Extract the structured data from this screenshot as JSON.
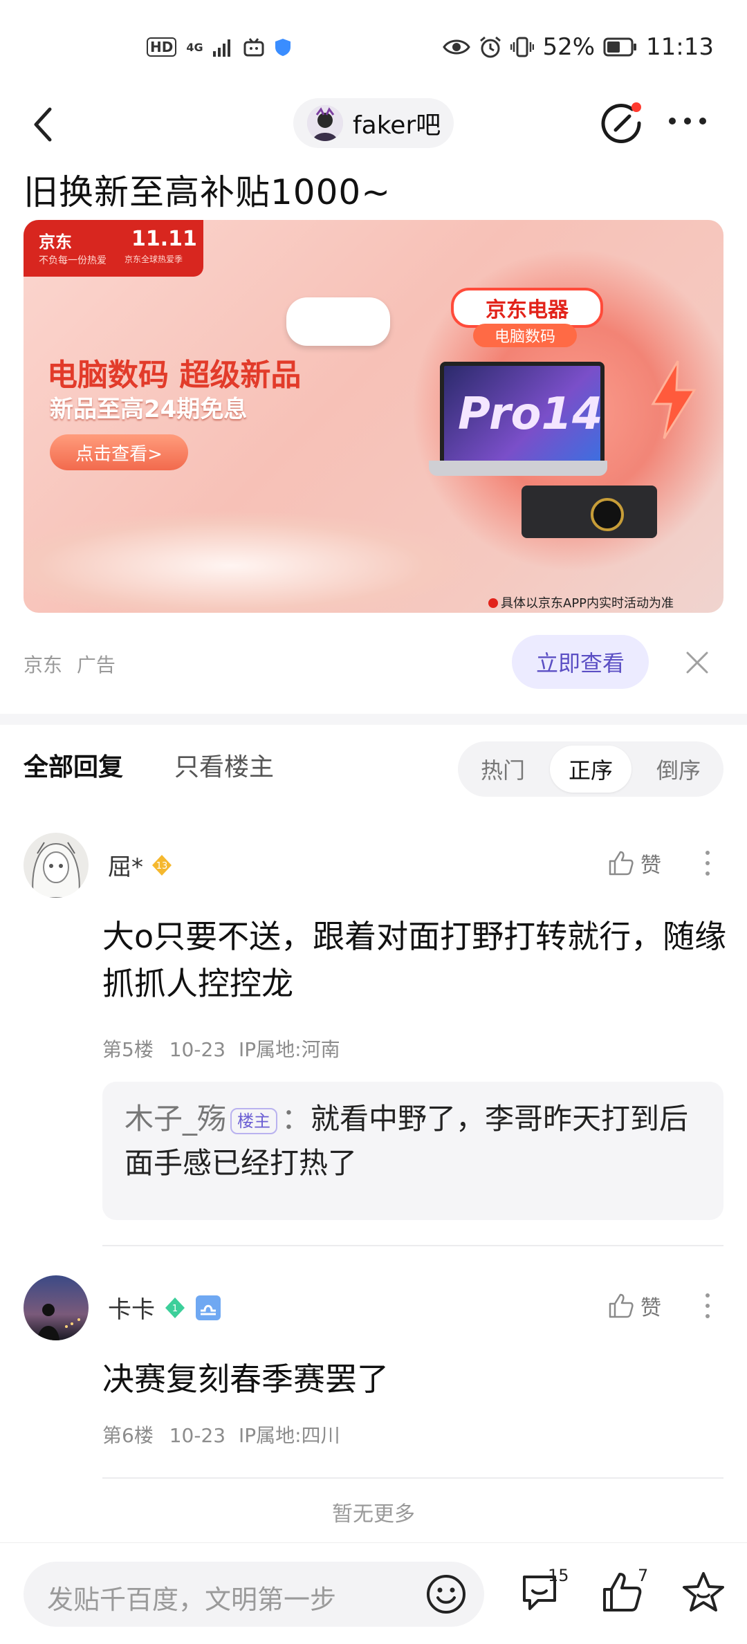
{
  "status_bar": {
    "hd": "HD",
    "network": "4G",
    "battery": "52%",
    "time": "11:13"
  },
  "nav": {
    "forum_name": "faker吧"
  },
  "headline": "旧换新至高补贴1000~",
  "ad": {
    "brand": "京东",
    "brand_tagline": "不负每一份热爱",
    "event": "11.11",
    "event_sub": "京东全球热爱季",
    "title": "电脑数码 超级新品",
    "subtitle": "新品至高24期免息",
    "cta": "点击查看>",
    "tag": "京东电器",
    "tag_sub": "电脑数码",
    "product_text": "Pro14",
    "note": "具体以京东APP内实时活动为准",
    "source": "京东",
    "label": "广告",
    "view_button": "立即查看"
  },
  "tabs": {
    "all": "全部回复",
    "op_only": "只看楼主",
    "sort": [
      {
        "label": "热门",
        "active": false
      },
      {
        "label": "正序",
        "active": true
      },
      {
        "label": "倒序",
        "active": false
      }
    ]
  },
  "posts": [
    {
      "username": "屈*",
      "level": "13",
      "level_color": "#f5b82e",
      "like_label": "赞",
      "text": "大o只要不送，跟着对面打野打转就行，随缘抓抓人控控龙",
      "floor": "第5楼",
      "date": "10-23",
      "ip": "IP属地:河南",
      "reply": {
        "name": "木子_殇",
        "tag": "楼主",
        "separator": "：",
        "text": "就看中野了，李哥昨天打到后面手感已经打热了"
      }
    },
    {
      "username": "卡卡",
      "level": "1",
      "level_color": "#3ccf9a",
      "like_label": "赞",
      "text": "决赛复刻春季赛罢了",
      "floor": "第6楼",
      "date": "10-23",
      "ip": "IP属地:四川"
    }
  ],
  "no_more": "暂无更多",
  "bottom_bar": {
    "compose_placeholder": "发贴千百度，文明第一步",
    "comment_count": "15",
    "like_count": "7"
  }
}
